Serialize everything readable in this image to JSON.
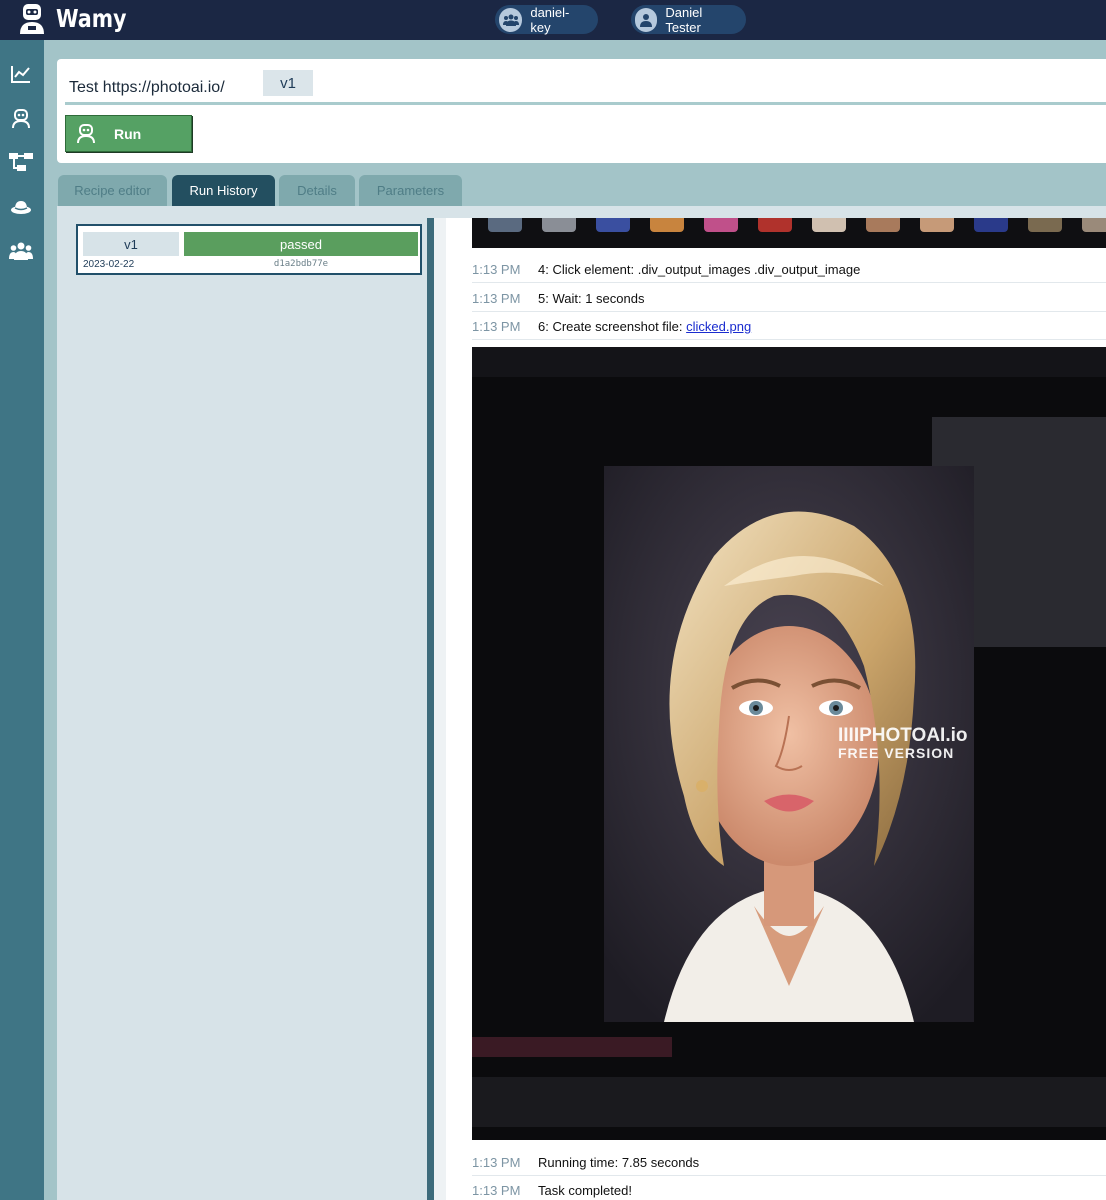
{
  "app": {
    "brand": "Wamy"
  },
  "header": {
    "team_label": "daniel-key",
    "user_label": "Daniel Tester"
  },
  "sidebar": {
    "items": [
      {
        "icon": "chart-line-icon"
      },
      {
        "icon": "robot-icon"
      },
      {
        "icon": "flow-diagram-icon"
      },
      {
        "icon": "hat-icon"
      },
      {
        "icon": "users-icon"
      }
    ]
  },
  "test": {
    "title": "Test https://photoai.io/",
    "version": "v1",
    "run_label": "Run"
  },
  "tabs": [
    {
      "label": "Recipe editor",
      "active": false
    },
    {
      "label": "Run History",
      "active": true
    },
    {
      "label": "Details",
      "active": false
    },
    {
      "label": "Parameters",
      "active": false
    }
  ],
  "runs": [
    {
      "version": "v1",
      "status": "passed",
      "date": "2023-02-22",
      "hash": "d1a2bdb77e"
    }
  ],
  "log": [
    {
      "time": "1:13 PM",
      "message": "4: Click element: .div_output_images .div_output_image"
    },
    {
      "time": "1:13 PM",
      "message": "5: Wait: 1 seconds"
    },
    {
      "time": "1:13 PM",
      "message": "6: Create screenshot file: ",
      "link": "clicked.png"
    },
    {
      "time": "1:13 PM",
      "message": "Running time: 7.85 seconds"
    },
    {
      "time": "1:13 PM",
      "message": "Task completed!"
    }
  ],
  "screenshot": {
    "watermark_line1": "IIIIPHOTOAI.io",
    "watermark_line2": "FREE VERSION"
  },
  "colors": {
    "topbar": "#1b2744",
    "sidebar": "#3f7585",
    "accent_green": "#55a164",
    "tab_active": "#234f60",
    "passed": "#5a9e5e"
  }
}
